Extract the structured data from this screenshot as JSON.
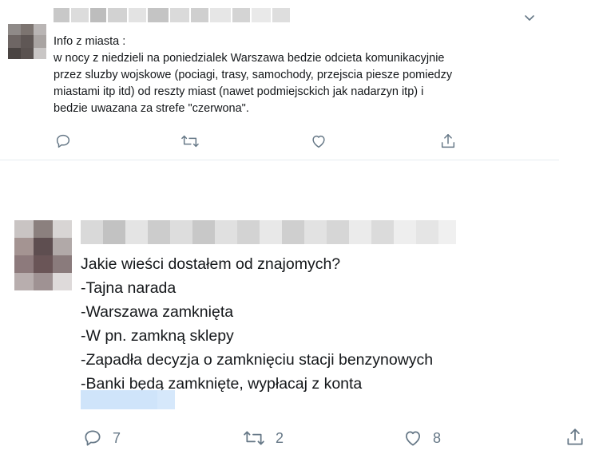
{
  "tweet1": {
    "text": "Info z miasta :\nw nocy z niedzieli na poniedzialek Warszawa bedzie odcieta komunikacyjnie\nprzez sluzby wojskowe (pociagi, trasy, samochody, przejscia piesze pomiedzy\nmiastami itp itd) od reszty miast (nawet podmiejsckich jak nadarzyn itp) i\nbedzie uwazana za strefe \"czerwona\"."
  },
  "tweet2": {
    "text": "Jakie wieści dostałem od znajomych?\n-Tajna narada\n-Warszawa zamknięta\n-W pn. zamkną sklepy\n-Zapadła decyzja o zamknięciu stacji benzynowych\n-Banki będą zamknięte, wypłacaj z konta",
    "reply_count": "7",
    "retweet_count": "2",
    "like_count": "8"
  },
  "colors": {
    "icon": "#657786",
    "text": "#14171a",
    "link_blur": "#d6e8fb"
  },
  "icons": [
    "chevron-down-icon",
    "reply-icon",
    "retweet-icon",
    "like-icon",
    "share-icon"
  ]
}
